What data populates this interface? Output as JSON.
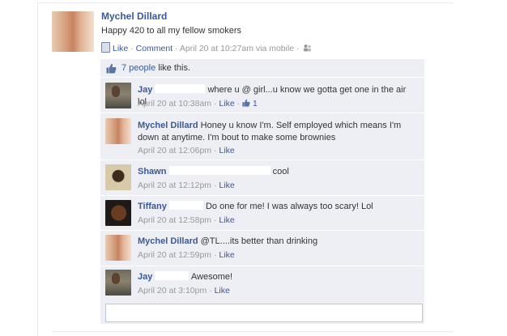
{
  "post": {
    "author": "Mychel Dillard",
    "text": "Happy 420 to all my fellow smokers",
    "like_label": "Like",
    "comment_label": "Comment",
    "time_via": "April 20 at 10:27am via mobile",
    "dot": "·"
  },
  "likes": {
    "count_text": "7 people",
    "suffix": "like this."
  },
  "comments": [
    {
      "author": "Jay",
      "text": "where u @ girl...u know we gotta get one in the air lol",
      "time": "April 20 at 10:38am",
      "like_label": "Like",
      "like_count": "1"
    },
    {
      "author": "Mychel Dillard",
      "text": "Honey u know I'm. Self employed which means I'm down at anytime. I'm bout to make some brownies",
      "time": "April 20 at 12:06pm",
      "like_label": "Like"
    },
    {
      "author": "Shawn",
      "text": "cool",
      "time": "April 20 at 12:12pm",
      "like_label": "Like"
    },
    {
      "author": "Tiffany",
      "text": "Do one for me! I was always too scary! Lol",
      "time": "April 20 at 12:58pm",
      "like_label": "Like"
    },
    {
      "author": "Mychel Dillard",
      "text": "@TL....its better than drinking",
      "time": "April 20 at 12:59pm",
      "like_label": "Like"
    },
    {
      "author": "Jay",
      "text": "Awesome!",
      "time": "April 20 at 3:10pm",
      "like_label": "Like"
    }
  ],
  "comment_input": {
    "placeholder": ""
  },
  "colors": {
    "link": "#3b5998",
    "panel": "#edeff4",
    "meta": "#999999"
  }
}
